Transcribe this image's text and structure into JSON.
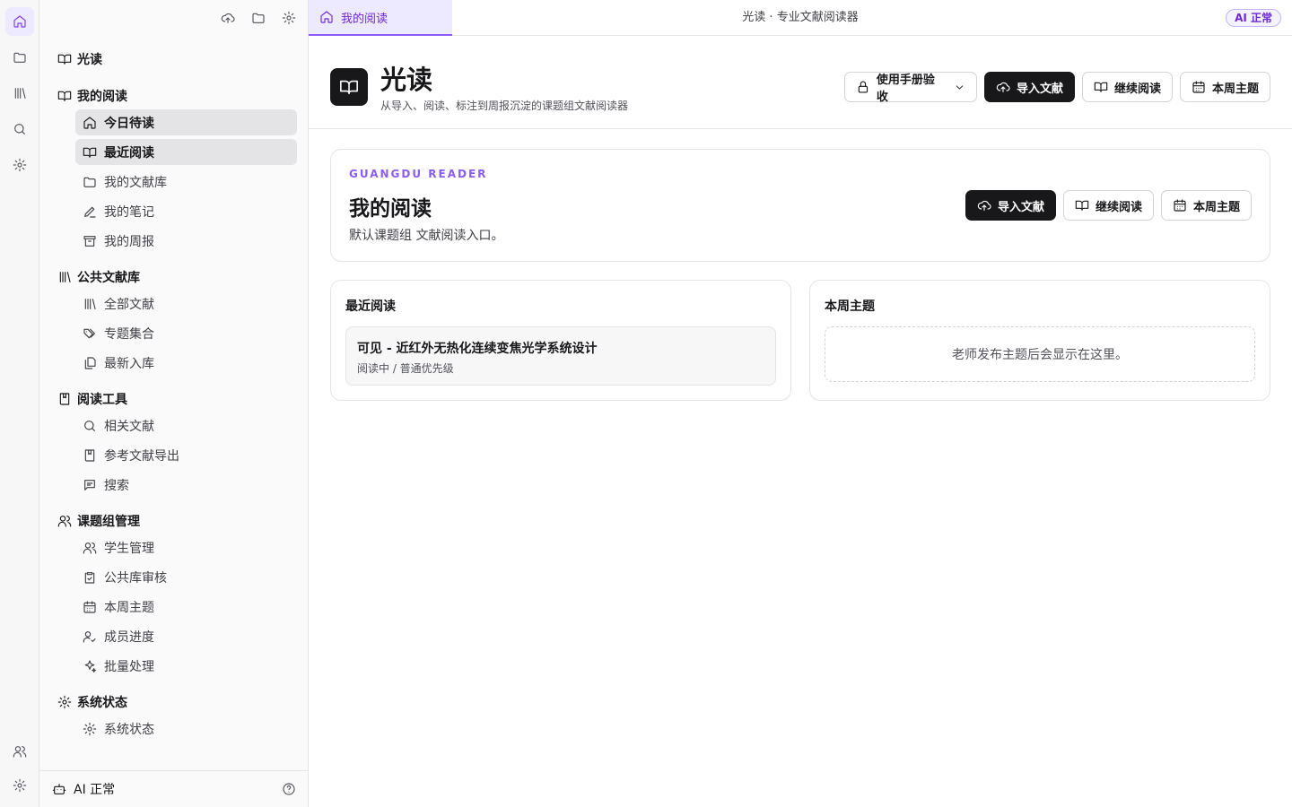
{
  "app": {
    "window_title": "光读 · 专业文献阅读器",
    "ai_badge": "AI 正常"
  },
  "tab": {
    "label": "我的阅读"
  },
  "sidebar": {
    "brand": "光读",
    "groups": [
      {
        "label": "我的阅读",
        "items": [
          "今日待读",
          "最近阅读",
          "我的文献库",
          "我的笔记",
          "我的周报"
        ]
      },
      {
        "label": "公共文献库",
        "items": [
          "全部文献",
          "专题集合",
          "最新入库"
        ]
      },
      {
        "label": "阅读工具",
        "items": [
          "相关文献",
          "参考文献导出",
          "搜索"
        ]
      },
      {
        "label": "课题组管理",
        "items": [
          "学生管理",
          "公共库审核",
          "本周主题",
          "成员进度",
          "批量处理"
        ]
      },
      {
        "label": "系统状态",
        "items": [
          "系统状态"
        ]
      }
    ],
    "selected": [
      "今日待读",
      "最近阅读"
    ],
    "footer": {
      "status": "AI 正常"
    }
  },
  "header": {
    "title": "光读",
    "subtitle": "从导入、阅读、标注到周报沉淀的课题组文献阅读器",
    "dropdown_label": "使用手册验收",
    "buttons": {
      "import": "导入文献",
      "continue": "继续阅读",
      "weekly": "本周主题"
    }
  },
  "hero": {
    "eyebrow": "GUANGDU READER",
    "title": "我的阅读",
    "desc": "默认课题组 文献阅读入口。",
    "buttons": {
      "import": "导入文献",
      "continue": "继续阅读",
      "weekly": "本周主题"
    }
  },
  "recent": {
    "title": "最近阅读",
    "doc_title": "可见 - 近红外无热化连续变焦光学系统设计",
    "doc_meta": "阅读中 / 普通优先级"
  },
  "weekly": {
    "title": "本周主题",
    "empty": "老师发布主题后会显示在这里。"
  }
}
